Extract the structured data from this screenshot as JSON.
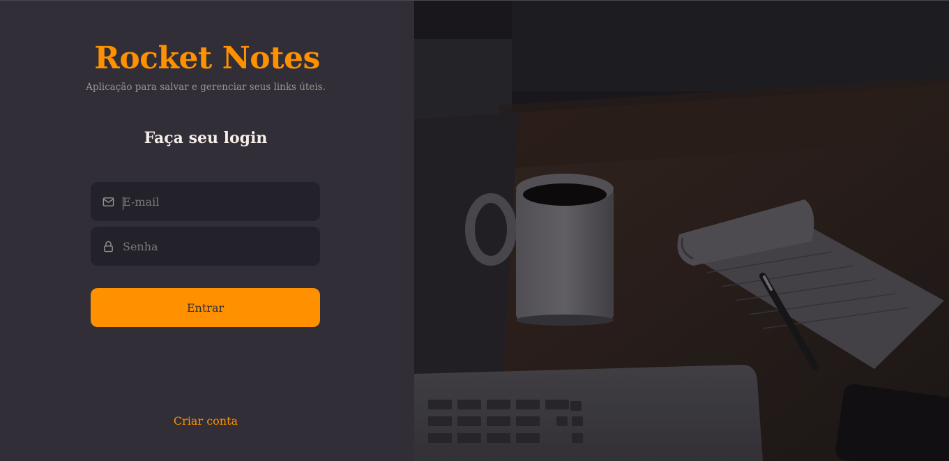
{
  "app": {
    "title": "Rocket Notes",
    "subtitle": "Aplicação para salvar e gerenciar seus links úteis."
  },
  "login": {
    "heading": "Faça seu login",
    "email_placeholder": "E-mail",
    "password_placeholder": "Senha",
    "submit_label": "Entrar",
    "create_account_label": "Criar conta"
  },
  "icons": {
    "email": "mail-icon",
    "password": "lock-icon"
  },
  "colors": {
    "accent": "#ff9000",
    "background": "#312e38",
    "input_background": "#232129",
    "text": "#f4ede8",
    "muted": "#999591"
  }
}
